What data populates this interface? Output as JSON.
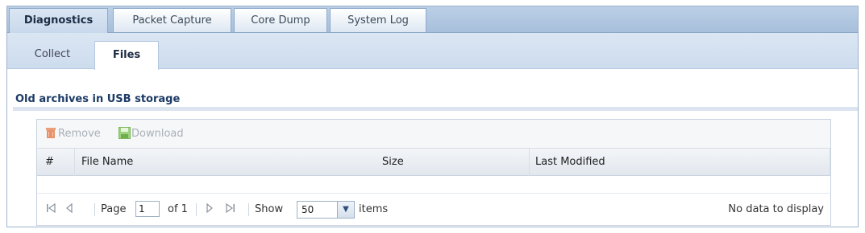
{
  "tabs": [
    {
      "label": "Diagnostics",
      "active": true
    },
    {
      "label": "Packet Capture",
      "active": false
    },
    {
      "label": "Core Dump",
      "active": false
    },
    {
      "label": "System Log",
      "active": false
    }
  ],
  "subtabs": [
    {
      "label": "Collect",
      "active": false
    },
    {
      "label": "Files",
      "active": true
    }
  ],
  "section": {
    "title": "Old archives in USB storage"
  },
  "toolbar": {
    "remove_label": "Remove",
    "remove_icon": "trash-icon",
    "download_label": "Download",
    "download_icon": "save-icon"
  },
  "table": {
    "columns": [
      "#",
      "File Name",
      "Size",
      "Last Modified"
    ],
    "rows": []
  },
  "pager": {
    "page_label": "Page",
    "page_value": "1",
    "of_label": "of 1",
    "show_label": "Show",
    "show_value": "50",
    "items_label": "items",
    "status": "No data to display"
  },
  "colors": {
    "accent": "#1c3a66",
    "tab_bar": "#bcd0e7",
    "subtab_bar": "#dbe6f3"
  }
}
